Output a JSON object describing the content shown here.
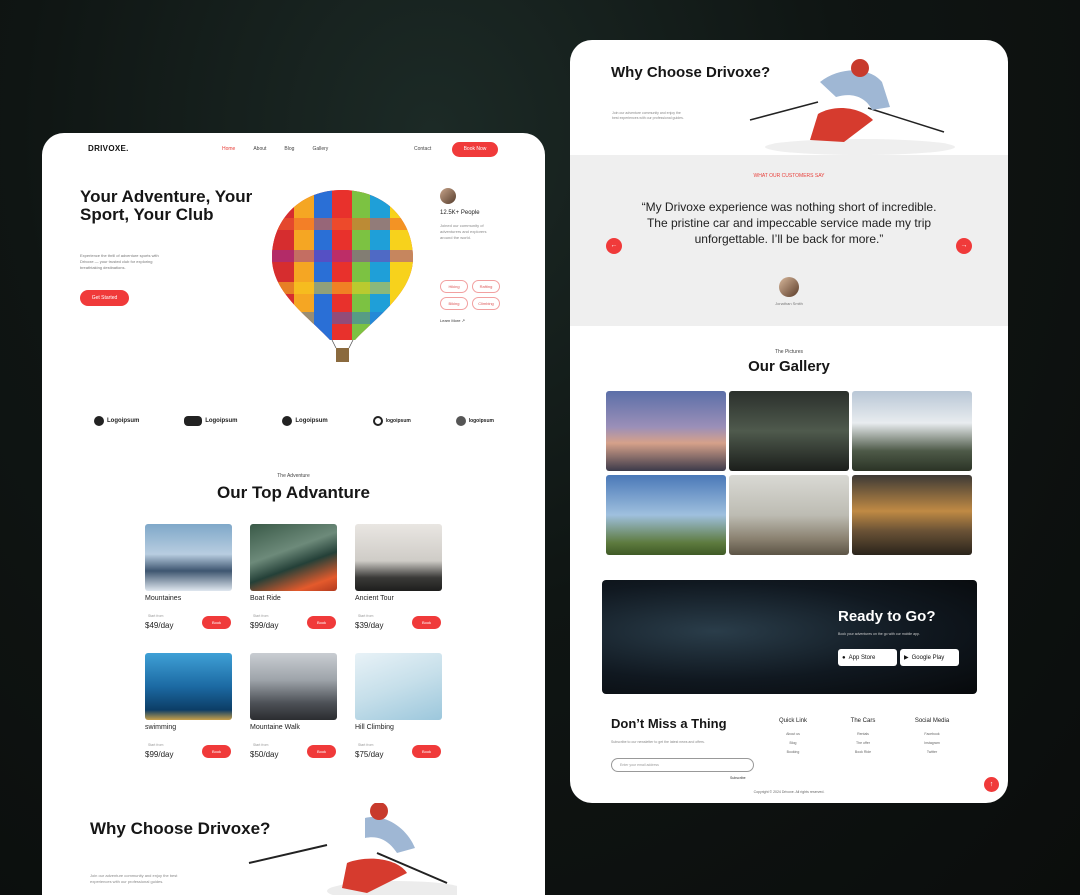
{
  "brand": {
    "logo": "DRIVOXE.",
    "accent": "#f03a3a"
  },
  "nav": {
    "links": [
      "Home",
      "About",
      "Blog",
      "Gallery"
    ],
    "contact": "Contact",
    "cta": "Book Now"
  },
  "hero": {
    "title": "Your Adventure, Your Sport, Your Club",
    "description": "Experience the thrill of adventure sports with Drivoxe — your trusted club for exploring breathtaking destinations.",
    "button": "Get Started",
    "people_count": "12.5K+ People",
    "people_desc": "Joined our community of adventurers and explorers around the world.",
    "tags": [
      "Hiking",
      "Rafting",
      "Biking",
      "Climbing"
    ],
    "learn_more": "Learn More ↗"
  },
  "logos": [
    "Logoipsum",
    "Logoipsum",
    "Logoipsum",
    "logoipsum",
    "logoipsum"
  ],
  "adventure": {
    "subtitle": "The Adventure",
    "title": "Our Top Advanture",
    "items": [
      {
        "name": "Mountaines",
        "start": "Start from",
        "price": "$49/day",
        "button": "Book"
      },
      {
        "name": "Boat Ride",
        "start": "Start from",
        "price": "$99/day",
        "button": "Book"
      },
      {
        "name": "Ancient Tour",
        "start": "Start from",
        "price": "$39/day",
        "button": "Book"
      },
      {
        "name": "swimming",
        "start": "Start from",
        "price": "$99/day",
        "button": "Book"
      },
      {
        "name": "Mountaine Walk",
        "start": "Start from",
        "price": "$50/day",
        "button": "Book"
      },
      {
        "name": "Hill Climbing",
        "start": "Start from",
        "price": "$75/day",
        "button": "Book"
      }
    ]
  },
  "why_choose": {
    "title": "Why Choose Drivoxe?",
    "description": "Join our adventure community and enjoy the best experiences with our professional guides."
  },
  "testimonial": {
    "label": "WHAT OUR CUSTOMERS SAY",
    "quote": "“My Drivoxe experience was nothing short of incredible. The pristine car and impeccable service made my trip unforgettable. I’ll be back for more.”",
    "prev": "←",
    "next": "→",
    "name": "Jonathan Smith"
  },
  "gallery": {
    "subtitle": "The Pictures",
    "title": "Our Gallery"
  },
  "ready": {
    "title": "Ready to Go?",
    "description": "Book your adventures on the go with our mobile app.",
    "app_store": "App Store",
    "google_play": "Google Play"
  },
  "footer": {
    "title": "Don’t Miss a Thing",
    "description": "Subscribe to our newsletter to get the latest news and offers.",
    "input_placeholder": "Enter your email address",
    "subscribe": "Subscribe",
    "columns": [
      {
        "head": "Quick Link",
        "items": [
          "About us",
          "Blog",
          "Booking"
        ]
      },
      {
        "head": "The Cars",
        "items": [
          "Rentals",
          "The offer",
          "Book Ride"
        ]
      },
      {
        "head": "Social Media",
        "items": [
          "Facebook",
          "Instagram",
          "Twitter"
        ]
      }
    ],
    "copyright": "Copyright © 2024 Drivoxe. All rights reserved.",
    "fab": "↑"
  }
}
